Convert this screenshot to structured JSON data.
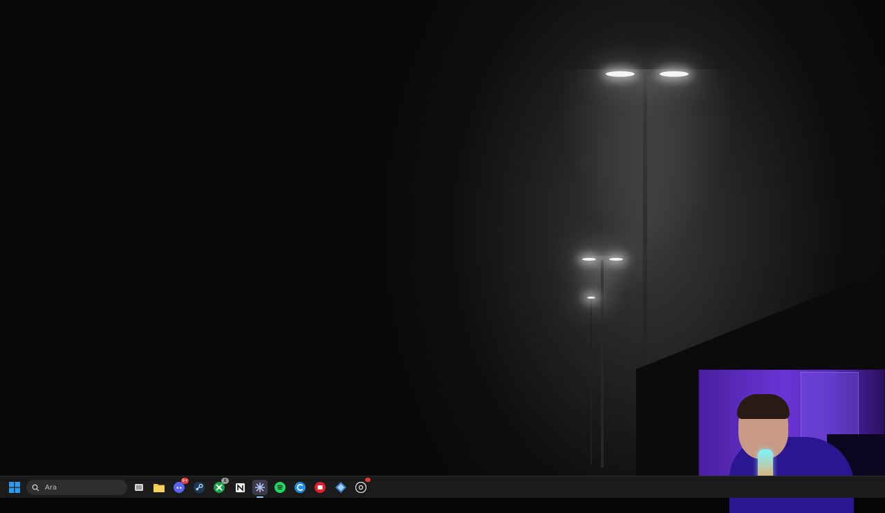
{
  "taskbar": {
    "search_placeholder": "Ara",
    "apps": [
      {
        "name": "task-view",
        "icon": "task-view-icon"
      },
      {
        "name": "file-explorer",
        "icon": "folder-icon"
      },
      {
        "name": "discord",
        "icon": "discord-icon",
        "badge": "9+"
      },
      {
        "name": "steam",
        "icon": "steam-icon"
      },
      {
        "name": "xbox",
        "icon": "xbox-icon",
        "badge": "8"
      },
      {
        "name": "notion",
        "icon": "notion-icon"
      },
      {
        "name": "perplexity",
        "icon": "perplexity-icon"
      },
      {
        "name": "spotify",
        "icon": "spotify-icon"
      },
      {
        "name": "edge-canary",
        "icon": "edge-icon"
      },
      {
        "name": "red-app",
        "icon": "red-app-icon"
      },
      {
        "name": "blue-app",
        "icon": "blue-app-icon"
      },
      {
        "name": "chrome",
        "icon": "chrome-icon"
      }
    ]
  },
  "colors": {
    "taskbar_bg": "#1b1b1b",
    "windows_blue": "#2b9cf2",
    "webcam_purple": "#6a34d4"
  }
}
